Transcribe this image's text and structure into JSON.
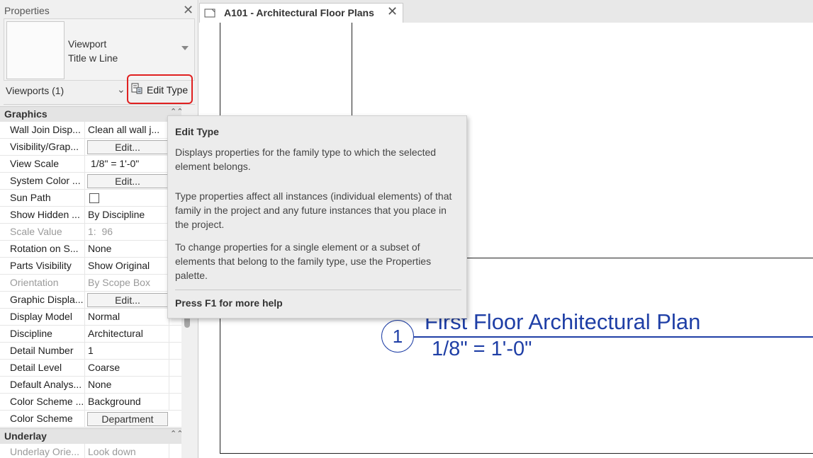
{
  "properties": {
    "title": "Properties",
    "close_glyph": "✕",
    "type_selector": {
      "line1": "Viewport",
      "line2": "Title w Line"
    },
    "instance_filter": "Viewports (1)",
    "edit_type_label": "Edit Type"
  },
  "groups": {
    "graphics": {
      "label": "Graphics",
      "collapse_glyph": "⌃⌃"
    },
    "underlay": {
      "label": "Underlay",
      "collapse_glyph": "⌃⌃"
    }
  },
  "rows": [
    {
      "key": "Wall Join Disp...",
      "value": "Clean all wall j..."
    },
    {
      "key": "Visibility/Grap...",
      "value": "Edit..."
    },
    {
      "key": "View Scale",
      "value": "1/8\" = 1'-0\""
    },
    {
      "key": "System Color ...",
      "value": "Edit..."
    },
    {
      "key": "Sun Path",
      "value": ""
    },
    {
      "key": "Show Hidden ...",
      "value": "By Discipline"
    },
    {
      "key": "Scale Value",
      "value": "1:  96"
    },
    {
      "key": "Rotation on S...",
      "value": "None"
    },
    {
      "key": "Parts Visibility",
      "value": "Show Original"
    },
    {
      "key": "Orientation",
      "value": "By Scope Box"
    },
    {
      "key": "Graphic Displa...",
      "value": "Edit..."
    },
    {
      "key": "Display Model",
      "value": "Normal"
    },
    {
      "key": "Discipline",
      "value": "Architectural"
    },
    {
      "key": "Detail Number",
      "value": "1"
    },
    {
      "key": "Detail Level",
      "value": "Coarse"
    },
    {
      "key": "Default Analys...",
      "value": "None"
    },
    {
      "key": "Color Scheme ...",
      "value": "Background"
    },
    {
      "key": "Color Scheme",
      "value": "Department"
    }
  ],
  "underlay_rows": [
    {
      "key": "Underlay Orie...",
      "value": "Look down"
    }
  ],
  "document_tab": {
    "title": "A101 - Architectural Floor Plans",
    "close_glyph": "✕"
  },
  "viewport_title": {
    "number": "1",
    "name": "First Floor Architectural Plan",
    "scale": "1/8\" = 1'-0\""
  },
  "tooltip": {
    "heading": "Edit Type",
    "p1": "Displays properties for the family type to which the selected element belongs.",
    "p2": "Type properties affect all instances (individual elements) of that family in the project and any future instances that you place in the project.",
    "p3": "To change properties for a single element or a subset of elements that belong to the family type, use the Properties palette.",
    "footer": "Press F1 for more help"
  },
  "colors": {
    "annotation_blue": "#1f3fa6",
    "highlight_red": "#e02020"
  }
}
